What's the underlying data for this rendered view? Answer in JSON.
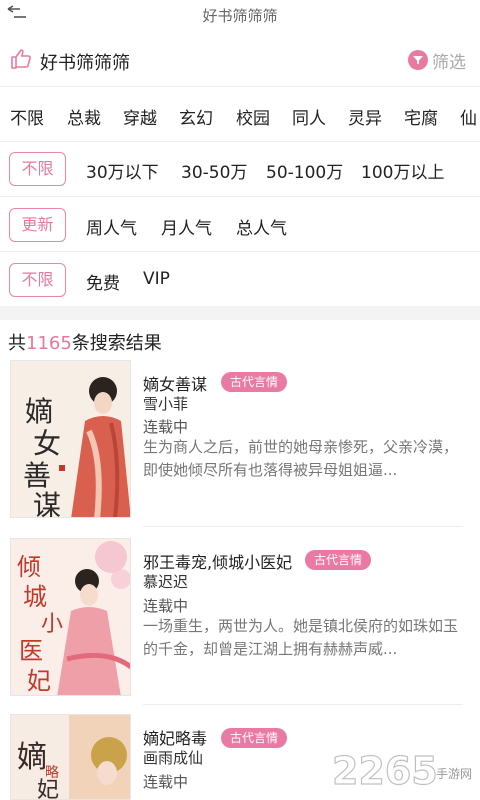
{
  "topbar": {
    "title": "好书筛筛筛"
  },
  "header": {
    "title": "好书筛筛筛",
    "filter_label": "筛选"
  },
  "categories": [
    "不限",
    "总裁",
    "穿越",
    "玄幻",
    "校园",
    "同人",
    "灵异",
    "宅腐",
    "仙"
  ],
  "word_count": {
    "selected": "不限",
    "options": [
      "30万以下",
      "30-50万",
      "50-100万",
      "100万以上"
    ]
  },
  "sort": {
    "selected": "更新",
    "options": [
      "周人气",
      "月人气",
      "总人气"
    ]
  },
  "price": {
    "selected": "不限",
    "options": [
      "免费",
      "VIP"
    ]
  },
  "results": {
    "prefix": "共",
    "count": "1165",
    "suffix": "条搜索结果"
  },
  "books": [
    {
      "title": "嫡女善谋",
      "tag": "古代言情",
      "author": "雪小菲",
      "status": "连载中",
      "desc1": "生为商人之后，前世的她母亲惨死，父亲冷漠，",
      "desc2": "即使她倾尽所有也落得被异母姐姐逼...",
      "cover_text": "嫡女善谋"
    },
    {
      "title": "邪王毒宠,倾城小医妃",
      "tag": "古代言情",
      "author": "慕迟迟",
      "status": "连载中",
      "desc1": "一场重生，两世为人。她是镇北侯府的如珠如玉",
      "desc2": "的千金，却曾是江湖上拥有赫赫声威...",
      "cover_text": "倾城小医妃"
    },
    {
      "title": "嫡妃略毒",
      "tag": "古代言情",
      "author": "画雨成仙",
      "status": "连载中",
      "desc1": "",
      "desc2": "",
      "cover_text": "嫡妃略毒"
    }
  ],
  "watermark": {
    "number": "2265",
    "site": "手游网"
  },
  "colors": {
    "accent": "#e87aa0",
    "divider": "#eeeeee"
  }
}
